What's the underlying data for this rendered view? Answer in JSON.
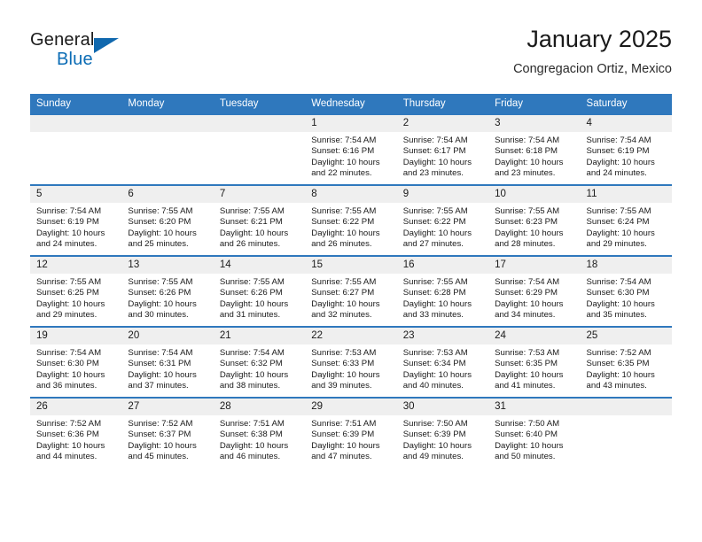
{
  "brand": {
    "word1": "General",
    "word2": "Blue",
    "triangle_icon": "triangle-icon",
    "color_primary": "#1068ae"
  },
  "header": {
    "title": "January 2025",
    "subtitle": "Congregacion Ortiz, Mexico",
    "accent_color": "#2f78bd"
  },
  "weekday_headers": [
    "Sunday",
    "Monday",
    "Tuesday",
    "Wednesday",
    "Thursday",
    "Friday",
    "Saturday"
  ],
  "labels": {
    "sunrise": "Sunrise:",
    "sunset": "Sunset:",
    "daylight": "Daylight:"
  },
  "weeks": [
    [
      {
        "day": "",
        "blank": true
      },
      {
        "day": "",
        "blank": true
      },
      {
        "day": "",
        "blank": true
      },
      {
        "day": "1",
        "sunrise": "Sunrise: 7:54 AM",
        "sunset": "Sunset: 6:16 PM",
        "daylight1": "Daylight: 10 hours",
        "daylight2": "and 22 minutes."
      },
      {
        "day": "2",
        "sunrise": "Sunrise: 7:54 AM",
        "sunset": "Sunset: 6:17 PM",
        "daylight1": "Daylight: 10 hours",
        "daylight2": "and 23 minutes."
      },
      {
        "day": "3",
        "sunrise": "Sunrise: 7:54 AM",
        "sunset": "Sunset: 6:18 PM",
        "daylight1": "Daylight: 10 hours",
        "daylight2": "and 23 minutes."
      },
      {
        "day": "4",
        "sunrise": "Sunrise: 7:54 AM",
        "sunset": "Sunset: 6:19 PM",
        "daylight1": "Daylight: 10 hours",
        "daylight2": "and 24 minutes."
      }
    ],
    [
      {
        "day": "5",
        "sunrise": "Sunrise: 7:54 AM",
        "sunset": "Sunset: 6:19 PM",
        "daylight1": "Daylight: 10 hours",
        "daylight2": "and 24 minutes."
      },
      {
        "day": "6",
        "sunrise": "Sunrise: 7:55 AM",
        "sunset": "Sunset: 6:20 PM",
        "daylight1": "Daylight: 10 hours",
        "daylight2": "and 25 minutes."
      },
      {
        "day": "7",
        "sunrise": "Sunrise: 7:55 AM",
        "sunset": "Sunset: 6:21 PM",
        "daylight1": "Daylight: 10 hours",
        "daylight2": "and 26 minutes."
      },
      {
        "day": "8",
        "sunrise": "Sunrise: 7:55 AM",
        "sunset": "Sunset: 6:22 PM",
        "daylight1": "Daylight: 10 hours",
        "daylight2": "and 26 minutes."
      },
      {
        "day": "9",
        "sunrise": "Sunrise: 7:55 AM",
        "sunset": "Sunset: 6:22 PM",
        "daylight1": "Daylight: 10 hours",
        "daylight2": "and 27 minutes."
      },
      {
        "day": "10",
        "sunrise": "Sunrise: 7:55 AM",
        "sunset": "Sunset: 6:23 PM",
        "daylight1": "Daylight: 10 hours",
        "daylight2": "and 28 minutes."
      },
      {
        "day": "11",
        "sunrise": "Sunrise: 7:55 AM",
        "sunset": "Sunset: 6:24 PM",
        "daylight1": "Daylight: 10 hours",
        "daylight2": "and 29 minutes."
      }
    ],
    [
      {
        "day": "12",
        "sunrise": "Sunrise: 7:55 AM",
        "sunset": "Sunset: 6:25 PM",
        "daylight1": "Daylight: 10 hours",
        "daylight2": "and 29 minutes."
      },
      {
        "day": "13",
        "sunrise": "Sunrise: 7:55 AM",
        "sunset": "Sunset: 6:26 PM",
        "daylight1": "Daylight: 10 hours",
        "daylight2": "and 30 minutes."
      },
      {
        "day": "14",
        "sunrise": "Sunrise: 7:55 AM",
        "sunset": "Sunset: 6:26 PM",
        "daylight1": "Daylight: 10 hours",
        "daylight2": "and 31 minutes."
      },
      {
        "day": "15",
        "sunrise": "Sunrise: 7:55 AM",
        "sunset": "Sunset: 6:27 PM",
        "daylight1": "Daylight: 10 hours",
        "daylight2": "and 32 minutes."
      },
      {
        "day": "16",
        "sunrise": "Sunrise: 7:55 AM",
        "sunset": "Sunset: 6:28 PM",
        "daylight1": "Daylight: 10 hours",
        "daylight2": "and 33 minutes."
      },
      {
        "day": "17",
        "sunrise": "Sunrise: 7:54 AM",
        "sunset": "Sunset: 6:29 PM",
        "daylight1": "Daylight: 10 hours",
        "daylight2": "and 34 minutes."
      },
      {
        "day": "18",
        "sunrise": "Sunrise: 7:54 AM",
        "sunset": "Sunset: 6:30 PM",
        "daylight1": "Daylight: 10 hours",
        "daylight2": "and 35 minutes."
      }
    ],
    [
      {
        "day": "19",
        "sunrise": "Sunrise: 7:54 AM",
        "sunset": "Sunset: 6:30 PM",
        "daylight1": "Daylight: 10 hours",
        "daylight2": "and 36 minutes."
      },
      {
        "day": "20",
        "sunrise": "Sunrise: 7:54 AM",
        "sunset": "Sunset: 6:31 PM",
        "daylight1": "Daylight: 10 hours",
        "daylight2": "and 37 minutes."
      },
      {
        "day": "21",
        "sunrise": "Sunrise: 7:54 AM",
        "sunset": "Sunset: 6:32 PM",
        "daylight1": "Daylight: 10 hours",
        "daylight2": "and 38 minutes."
      },
      {
        "day": "22",
        "sunrise": "Sunrise: 7:53 AM",
        "sunset": "Sunset: 6:33 PM",
        "daylight1": "Daylight: 10 hours",
        "daylight2": "and 39 minutes."
      },
      {
        "day": "23",
        "sunrise": "Sunrise: 7:53 AM",
        "sunset": "Sunset: 6:34 PM",
        "daylight1": "Daylight: 10 hours",
        "daylight2": "and 40 minutes."
      },
      {
        "day": "24",
        "sunrise": "Sunrise: 7:53 AM",
        "sunset": "Sunset: 6:35 PM",
        "daylight1": "Daylight: 10 hours",
        "daylight2": "and 41 minutes."
      },
      {
        "day": "25",
        "sunrise": "Sunrise: 7:52 AM",
        "sunset": "Sunset: 6:35 PM",
        "daylight1": "Daylight: 10 hours",
        "daylight2": "and 43 minutes."
      }
    ],
    [
      {
        "day": "26",
        "sunrise": "Sunrise: 7:52 AM",
        "sunset": "Sunset: 6:36 PM",
        "daylight1": "Daylight: 10 hours",
        "daylight2": "and 44 minutes."
      },
      {
        "day": "27",
        "sunrise": "Sunrise: 7:52 AM",
        "sunset": "Sunset: 6:37 PM",
        "daylight1": "Daylight: 10 hours",
        "daylight2": "and 45 minutes."
      },
      {
        "day": "28",
        "sunrise": "Sunrise: 7:51 AM",
        "sunset": "Sunset: 6:38 PM",
        "daylight1": "Daylight: 10 hours",
        "daylight2": "and 46 minutes."
      },
      {
        "day": "29",
        "sunrise": "Sunrise: 7:51 AM",
        "sunset": "Sunset: 6:39 PM",
        "daylight1": "Daylight: 10 hours",
        "daylight2": "and 47 minutes."
      },
      {
        "day": "30",
        "sunrise": "Sunrise: 7:50 AM",
        "sunset": "Sunset: 6:39 PM",
        "daylight1": "Daylight: 10 hours",
        "daylight2": "and 49 minutes."
      },
      {
        "day": "31",
        "sunrise": "Sunrise: 7:50 AM",
        "sunset": "Sunset: 6:40 PM",
        "daylight1": "Daylight: 10 hours",
        "daylight2": "and 50 minutes."
      },
      {
        "day": "",
        "blank": true
      }
    ]
  ]
}
